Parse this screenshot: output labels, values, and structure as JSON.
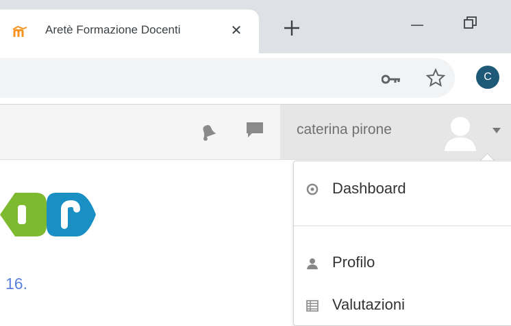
{
  "browser": {
    "tab_title": "Aretè Formazione Docenti",
    "new_tab_icon": "plus-icon",
    "profile_initial": "C",
    "colors": {
      "tabstrip": "#dee1e6",
      "profile": "#1e5a78"
    }
  },
  "navbar": {
    "user_name": "caterina pirone",
    "icons": [
      "bell-icon",
      "chat-icon",
      "user-avatar-icon",
      "caret-down-icon"
    ]
  },
  "content": {
    "date_fragment": "16."
  },
  "user_menu": {
    "items": [
      {
        "label": "Dashboard",
        "icon": "dashboard-icon"
      },
      {
        "label": "Profilo",
        "icon": "user-icon"
      },
      {
        "label": "Valutazioni",
        "icon": "grades-icon"
      }
    ]
  }
}
